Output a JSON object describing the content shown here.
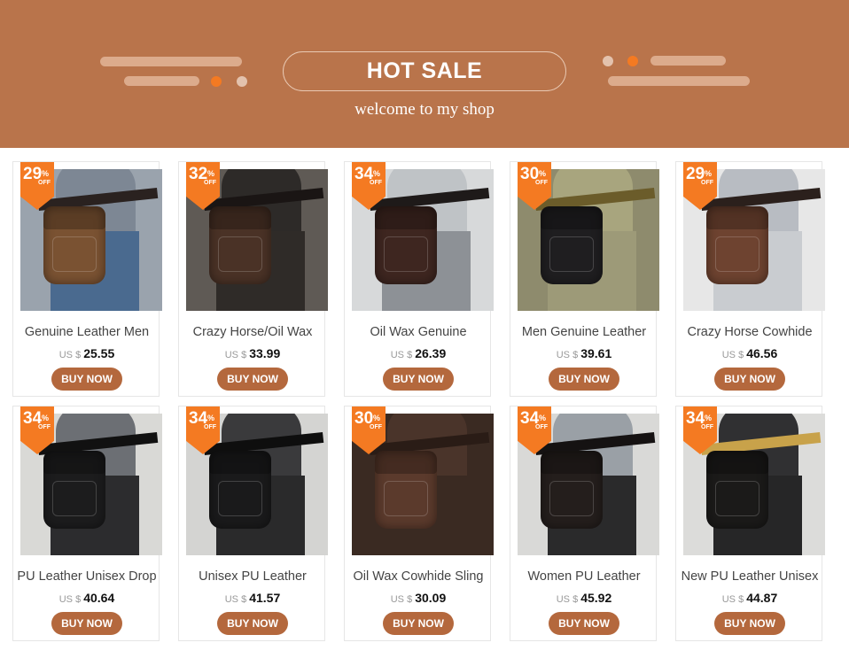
{
  "banner": {
    "title": "HOT SALE",
    "subtitle": "welcome to my shop",
    "bg_color": "#b9744b",
    "accent_color": "#f47a22"
  },
  "products": [
    {
      "discount": "29",
      "pct": "%",
      "off": "OFF",
      "title": "Genuine Leather Men",
      "currency": "US $",
      "price": "25.55",
      "button": "BUY NOW",
      "scene": {
        "bg": "#9aa3ad",
        "torso": "#7d8794",
        "legs": "#4a6a8f",
        "bag": "#7a5232",
        "belt": "#2a2220"
      }
    },
    {
      "discount": "32",
      "pct": "%",
      "off": "OFF",
      "title": "Crazy Horse/Oil Wax",
      "currency": "US $",
      "price": "33.99",
      "button": "BUY NOW",
      "scene": {
        "bg": "#5f5a55",
        "torso": "#2d2a28",
        "legs": "#2f2b28",
        "bag": "#4a3226",
        "belt": "#1a1514"
      }
    },
    {
      "discount": "34",
      "pct": "%",
      "off": "OFF",
      "title": "Oil Wax Genuine",
      "currency": "US $",
      "price": "26.39",
      "button": "BUY NOW",
      "scene": {
        "bg": "#d7d9da",
        "torso": "#bfc3c6",
        "legs": "#8d9196",
        "bag": "#3e2620",
        "belt": "#1e1a19"
      }
    },
    {
      "discount": "30",
      "pct": "%",
      "off": "OFF",
      "title": "Men Genuine Leather",
      "currency": "US $",
      "price": "39.61",
      "button": "BUY NOW",
      "scene": {
        "bg": "#8e8b6d",
        "torso": "#a8a57e",
        "legs": "#9d9a78",
        "bag": "#1f1e20",
        "belt": "#6b5c2a"
      }
    },
    {
      "discount": "29",
      "pct": "%",
      "off": "OFF",
      "title": "Crazy Horse Cowhide",
      "currency": "US $",
      "price": "46.56",
      "button": "BUY NOW",
      "scene": {
        "bg": "#e7e7e7",
        "torso": "#b8bcc2",
        "legs": "#c9ccd0",
        "bag": "#6e4330",
        "belt": "#2b201c"
      }
    },
    {
      "discount": "34",
      "pct": "%",
      "off": "OFF",
      "title": "PU Leather Unisex Drop",
      "currency": "US $",
      "price": "40.64",
      "button": "BUY NOW",
      "scene": {
        "bg": "#d9d9d6",
        "torso": "#6c6f74",
        "legs": "#2c2c2e",
        "bag": "#1c1c1d",
        "belt": "#111111"
      }
    },
    {
      "discount": "34",
      "pct": "%",
      "off": "OFF",
      "title": "Unisex PU Leather",
      "currency": "US $",
      "price": "41.57",
      "button": "BUY NOW",
      "scene": {
        "bg": "#d4d4d2",
        "torso": "#3a3a3c",
        "legs": "#2a2a2b",
        "bag": "#1a1a1b",
        "belt": "#0e0e0e"
      }
    },
    {
      "discount": "30",
      "pct": "%",
      "off": "OFF",
      "title": "Oil Wax Cowhide Sling",
      "currency": "US $",
      "price": "30.09",
      "button": "BUY NOW",
      "scene": {
        "bg": "#3a2a22",
        "torso": "#4a342a",
        "legs": "#3a2a22",
        "bag": "#5b3a2c",
        "belt": "#2a1c16"
      }
    },
    {
      "discount": "34",
      "pct": "%",
      "off": "OFF",
      "title": "Women PU Leather",
      "currency": "US $",
      "price": "45.92",
      "button": "BUY NOW",
      "scene": {
        "bg": "#d9d9d7",
        "torso": "#9aa0a6",
        "legs": "#2a2a2b",
        "bag": "#241e1c",
        "belt": "#151212"
      }
    },
    {
      "discount": "34",
      "pct": "%",
      "off": "OFF",
      "title": "New PU Leather Unisex",
      "currency": "US $",
      "price": "44.87",
      "button": "BUY NOW",
      "scene": {
        "bg": "#dcdcda",
        "torso": "#303032",
        "legs": "#262627",
        "bag": "#1b1a19",
        "belt": "#c8a24a"
      }
    }
  ]
}
